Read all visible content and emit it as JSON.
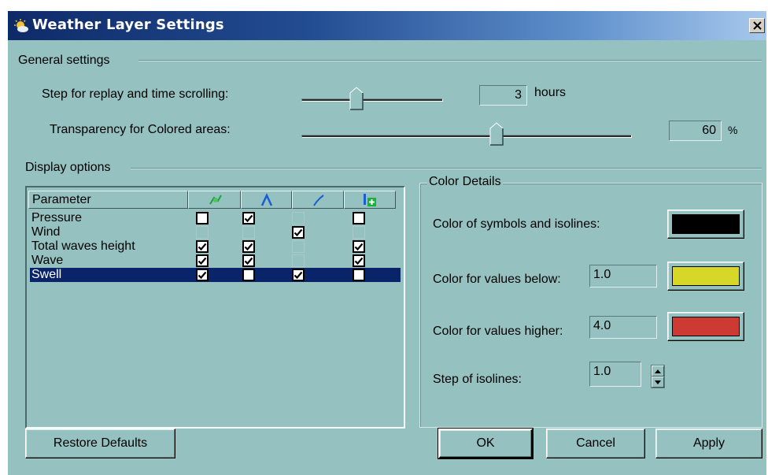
{
  "window": {
    "title": "Weather Layer Settings"
  },
  "general": {
    "legend": "General settings",
    "step_label": "Step for replay and time scrolling:",
    "step_value": "3",
    "step_unit": "hours",
    "transparency_label": "Transparency for Colored areas:",
    "transparency_value": "60",
    "transparency_unit": "%"
  },
  "display": {
    "legend": "Display options",
    "columns": [
      {
        "label": "Parameter"
      },
      {
        "icon": "symbols-icon"
      },
      {
        "icon": "isolines-icon"
      },
      {
        "icon": "arrows-icon"
      },
      {
        "icon": "colored-areas-icon"
      }
    ],
    "rows": [
      {
        "name": "Pressure",
        "checks": [
          [
            false,
            true
          ],
          [
            true,
            true
          ],
          [
            false,
            false
          ],
          [
            false,
            true
          ]
        ],
        "selected": false
      },
      {
        "name": "Wind",
        "checks": [
          [
            false,
            false
          ],
          [
            false,
            false
          ],
          [
            true,
            true
          ],
          [
            false,
            false
          ]
        ],
        "selected": false
      },
      {
        "name": "Total waves height",
        "checks": [
          [
            true,
            true
          ],
          [
            true,
            true
          ],
          [
            false,
            false
          ],
          [
            true,
            true
          ]
        ],
        "selected": false
      },
      {
        "name": "Wave",
        "checks": [
          [
            true,
            true
          ],
          [
            true,
            true
          ],
          [
            false,
            false
          ],
          [
            true,
            true
          ]
        ],
        "selected": false
      },
      {
        "name": "Swell",
        "checks": [
          [
            true,
            true
          ],
          [
            false,
            true
          ],
          [
            true,
            true
          ],
          [
            false,
            true
          ]
        ],
        "selected": true
      }
    ]
  },
  "color_details": {
    "legend": "Color Details",
    "symbols_label": "Color of symbols and isolines:",
    "symbols_color": "#000000",
    "below_label": "Color for values below:",
    "below_value": "1.0",
    "below_color": "#d7d72a",
    "higher_label": "Color for values higher:",
    "higher_value": "4.0",
    "higher_color": "#cc3a33",
    "step_label": "Step of isolines:",
    "step_value": "1.0"
  },
  "buttons": {
    "restore": "Restore Defaults",
    "ok": "OK",
    "cancel": "Cancel",
    "apply": "Apply"
  }
}
